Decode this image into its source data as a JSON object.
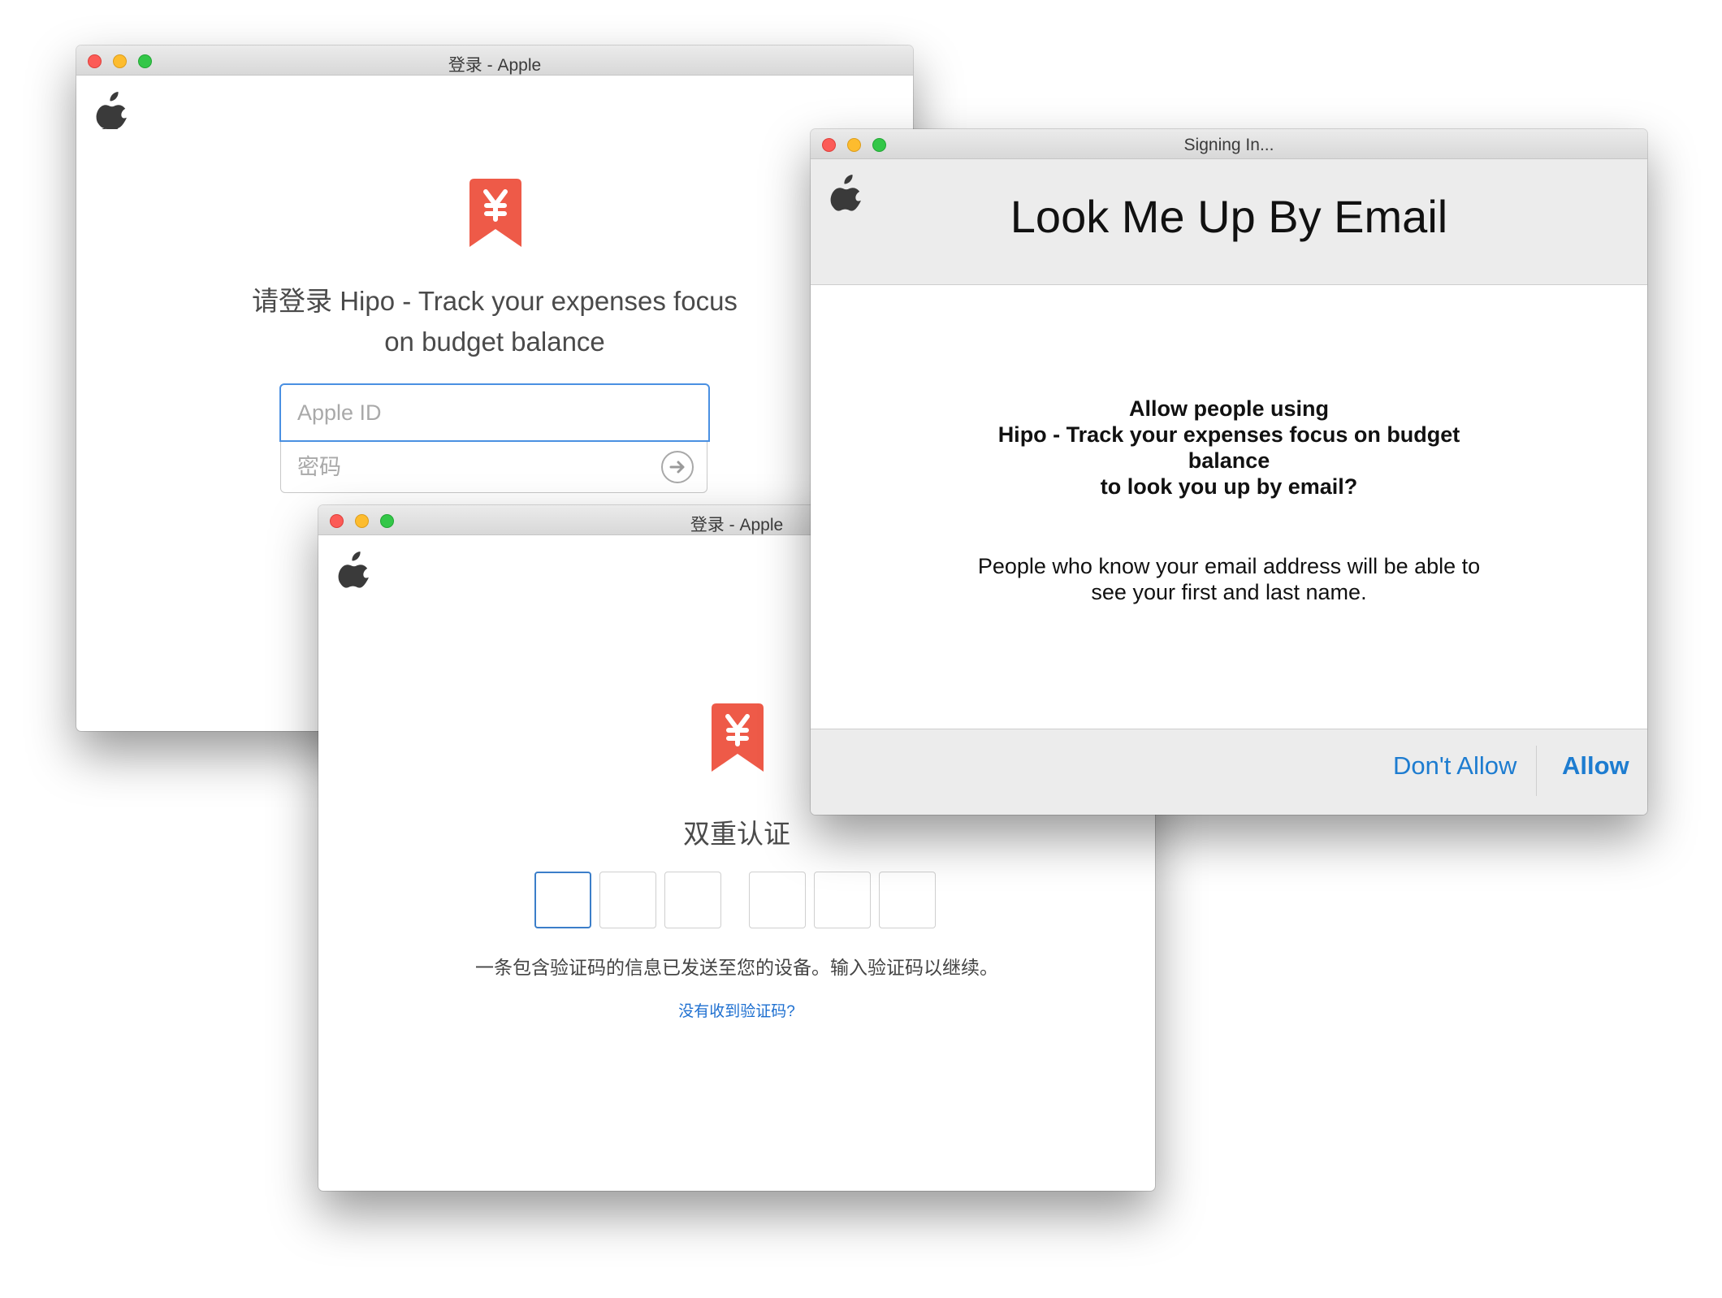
{
  "colors": {
    "accent_link": "#1d7cd0",
    "app_icon_red": "#ee5a48",
    "focus_blue": "#4a90e2",
    "close_red": "#fc5b57",
    "minimize_yellow": "#fdbc2e",
    "zoom_green": "#33c748"
  },
  "icons": [
    "apple-logo-icon",
    "app-bookmark-yen-icon",
    "arrow-right-circle-icon",
    "traffic-light-close",
    "traffic-light-minimize",
    "traffic-light-zoom"
  ],
  "signin_window": {
    "title": "登录 - Apple",
    "prompt_line1": "请登录 Hipo - Track your expenses focus",
    "prompt_line2": "on budget balance",
    "apple_id_placeholder": "Apple ID",
    "password_placeholder": "密码"
  },
  "twofactor_window": {
    "title": "登录 - Apple",
    "heading": "双重认证",
    "code_digits": [
      "",
      "",
      "",
      "",
      "",
      ""
    ],
    "message": "一条包含验证码的信息已发送至您的设备。输入验证码以继续。",
    "resend_link": "没有收到验证码?"
  },
  "lookup_window": {
    "title": "Signing In...",
    "heading": "Look Me Up By Email",
    "question_line1": "Allow people using",
    "question_line2": "Hipo - Track your expenses focus on budget",
    "question_line3": "balance",
    "question_line4": "to look you up by email?",
    "explain_line1": "People who know your email address will be able to",
    "explain_line2": "see your first and last name.",
    "dont_allow_label": "Don't Allow",
    "allow_label": "Allow"
  }
}
